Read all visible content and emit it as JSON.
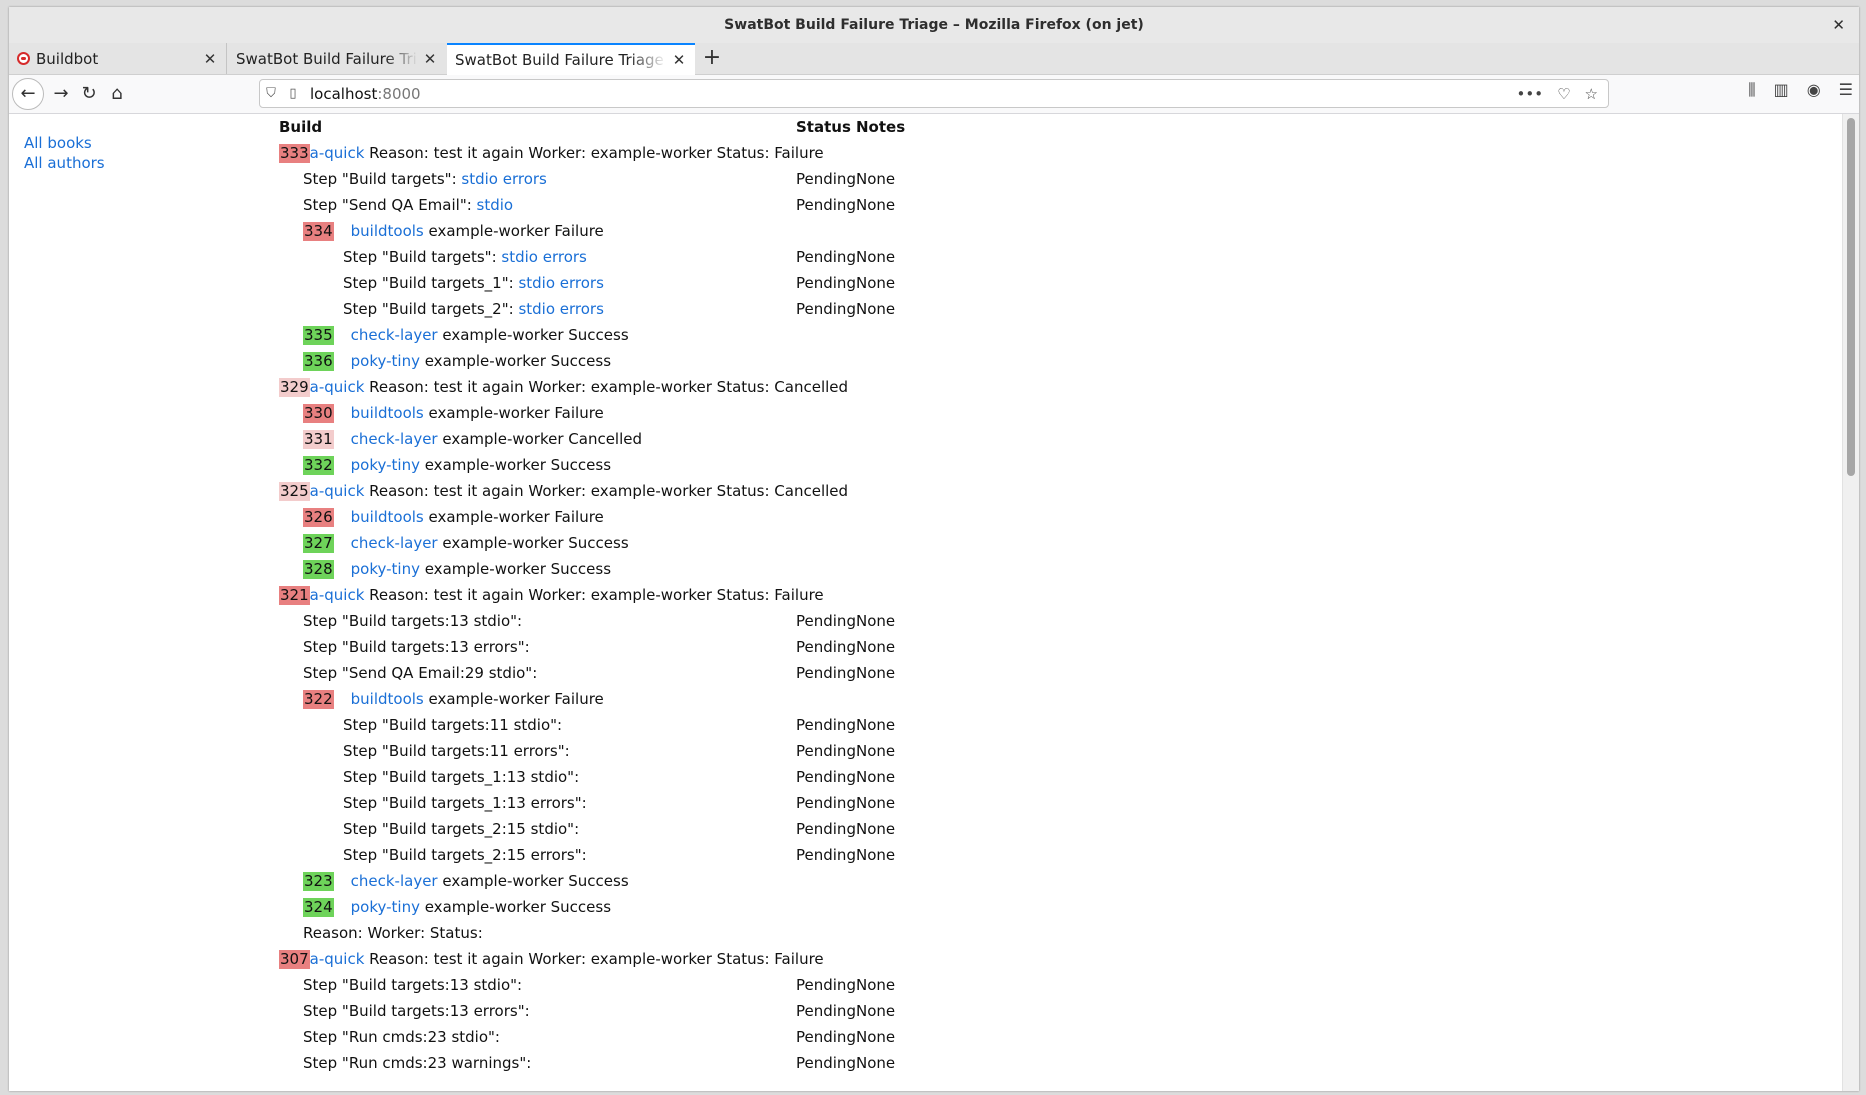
{
  "window": {
    "title": "SwatBot Build Failure Triage – Mozilla Firefox (on jet)"
  },
  "tabs": [
    {
      "label": "Buildbot"
    },
    {
      "label": "SwatBot Build Failure Triage"
    },
    {
      "label": "SwatBot Build Failure Triage"
    }
  ],
  "address": {
    "host": "localhost",
    "port": ":8000"
  },
  "sidenav": {
    "all_books": "All books",
    "all_authors": "All authors"
  },
  "table": {
    "col_build": "Build",
    "col_status": "Status",
    "col_notes": "Notes"
  },
  "rows": [
    {
      "indent": 0,
      "num": "333",
      "state": "fail",
      "link": "a-quick",
      "text": " Reason: test it again Worker: example-worker Status: Failure"
    },
    {
      "indent": 1,
      "text": "Step \"Build targets\": ",
      "links": [
        "stdio",
        "errors"
      ],
      "status": "Pending",
      "notes": "None"
    },
    {
      "indent": 1,
      "text": "Step \"Send QA Email\": ",
      "links": [
        "stdio"
      ],
      "status": "Pending",
      "notes": "None"
    },
    {
      "indent": 1,
      "num": "334",
      "state": "fail",
      "link": "buildtools",
      "text": " example-worker Failure"
    },
    {
      "indent": 2,
      "text": "Step \"Build targets\": ",
      "links": [
        "stdio",
        "errors"
      ],
      "status": "Pending",
      "notes": "None"
    },
    {
      "indent": 2,
      "text": "Step \"Build targets_1\": ",
      "links": [
        "stdio",
        "errors"
      ],
      "status": "Pending",
      "notes": "None"
    },
    {
      "indent": 2,
      "text": "Step \"Build targets_2\": ",
      "links": [
        "stdio",
        "errors"
      ],
      "status": "Pending",
      "notes": "None"
    },
    {
      "indent": 1,
      "num": "335",
      "state": "succ",
      "link": "check-layer",
      "text": " example-worker Success"
    },
    {
      "indent": 1,
      "num": "336",
      "state": "succ",
      "link": "poky-tiny",
      "text": " example-worker Success"
    },
    {
      "indent": 0,
      "num": "329",
      "state": "canc",
      "link": "a-quick",
      "text": " Reason: test it again Worker: example-worker Status: Cancelled"
    },
    {
      "indent": 1,
      "num": "330",
      "state": "fail",
      "link": "buildtools",
      "text": " example-worker Failure"
    },
    {
      "indent": 1,
      "num": "331",
      "state": "canc",
      "link": "check-layer",
      "text": " example-worker Cancelled"
    },
    {
      "indent": 1,
      "num": "332",
      "state": "succ",
      "link": "poky-tiny",
      "text": " example-worker Success"
    },
    {
      "indent": 0,
      "num": "325",
      "state": "canc",
      "link": "a-quick",
      "text": " Reason: test it again Worker: example-worker Status: Cancelled"
    },
    {
      "indent": 1,
      "num": "326",
      "state": "fail",
      "link": "buildtools",
      "text": " example-worker Failure"
    },
    {
      "indent": 1,
      "num": "327",
      "state": "succ",
      "link": "check-layer",
      "text": " example-worker Success"
    },
    {
      "indent": 1,
      "num": "328",
      "state": "succ",
      "link": "poky-tiny",
      "text": " example-worker Success"
    },
    {
      "indent": 0,
      "num": "321",
      "state": "fail",
      "link": "a-quick",
      "text": " Reason: test it again Worker: example-worker Status: Failure"
    },
    {
      "indent": 1,
      "text": "Step \"Build targets:13 stdio\":",
      "status": "Pending",
      "notes": "None"
    },
    {
      "indent": 1,
      "text": "Step \"Build targets:13 errors\":",
      "status": "Pending",
      "notes": "None"
    },
    {
      "indent": 1,
      "text": "Step \"Send QA Email:29 stdio\":",
      "status": "Pending",
      "notes": "None"
    },
    {
      "indent": 1,
      "num": "322",
      "state": "fail",
      "link": "buildtools",
      "text": " example-worker Failure"
    },
    {
      "indent": 2,
      "text": "Step \"Build targets:11 stdio\":",
      "status": "Pending",
      "notes": "None"
    },
    {
      "indent": 2,
      "text": "Step \"Build targets:11 errors\":",
      "status": "Pending",
      "notes": "None"
    },
    {
      "indent": 2,
      "text": "Step \"Build targets_1:13 stdio\":",
      "status": "Pending",
      "notes": "None"
    },
    {
      "indent": 2,
      "text": "Step \"Build targets_1:13 errors\":",
      "status": "Pending",
      "notes": "None"
    },
    {
      "indent": 2,
      "text": "Step \"Build targets_2:15 stdio\":",
      "status": "Pending",
      "notes": "None"
    },
    {
      "indent": 2,
      "text": "Step \"Build targets_2:15 errors\":",
      "status": "Pending",
      "notes": "None"
    },
    {
      "indent": 1,
      "num": "323",
      "state": "succ",
      "link": "check-layer",
      "text": " example-worker Success"
    },
    {
      "indent": 1,
      "num": "324",
      "state": "succ",
      "link": "poky-tiny",
      "text": " example-worker Success"
    },
    {
      "indent": 1,
      "text": "Reason: Worker: Status:"
    },
    {
      "indent": 0,
      "num": "307",
      "state": "fail",
      "link": "a-quick",
      "text": " Reason: test it again Worker: example-worker Status: Failure"
    },
    {
      "indent": 1,
      "text": "Step \"Build targets:13 stdio\":",
      "status": "Pending",
      "notes": "None"
    },
    {
      "indent": 1,
      "text": "Step \"Build targets:13 errors\":",
      "status": "Pending",
      "notes": "None"
    },
    {
      "indent": 1,
      "text": "Step \"Run cmds:23 stdio\":",
      "status": "Pending",
      "notes": "None"
    },
    {
      "indent": 1,
      "text": "Step \"Run cmds:23 warnings\":",
      "status": "Pending",
      "notes": "None"
    }
  ]
}
